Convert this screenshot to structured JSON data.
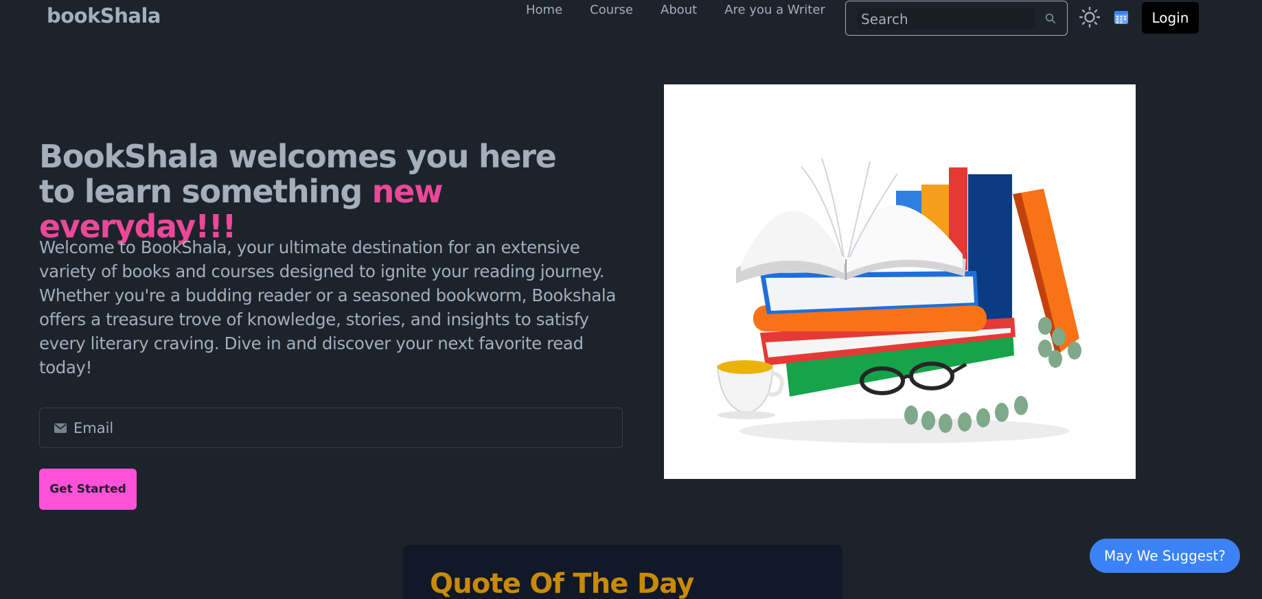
{
  "navbar": {
    "logo": "bookShala",
    "links": [
      "Home",
      "Course",
      "About",
      "Are you a Writer"
    ],
    "search_placeholder": "Search",
    "login_label": "Login"
  },
  "hero": {
    "title_main": "BookShala welcomes you here to learn something ",
    "title_accent": "new everyday!!!",
    "description": "Welcome to BookShala, your ultimate destination for an extensive variety of books and courses designed to ignite your reading journey. Whether you're a budding reader or a seasoned bookworm, Bookshala offers a treasure trove of knowledge, stories, and insights to satisfy every literary craving. Dive in and discover your next favorite read today!",
    "email_placeholder": "Email",
    "cta_label": "Get Started"
  },
  "quote": {
    "title": "Quote Of The Day"
  },
  "suggest_label": "May We Suggest?",
  "colors": {
    "background": "#1d232a",
    "text": "#a6adbb",
    "accent_pink": "#ec4899",
    "cta_pink": "#ff52d9",
    "quote_gold": "#ca8a04",
    "suggest_blue": "#3b82f6"
  }
}
